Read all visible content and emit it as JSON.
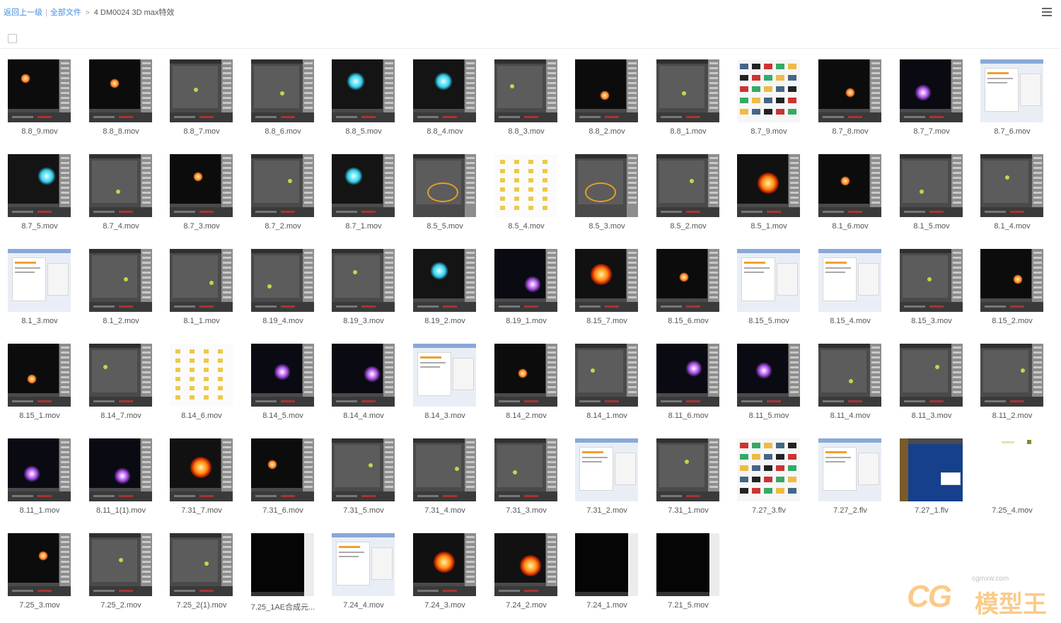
{
  "breadcrumb": {
    "back_label": "返回上一级",
    "all_files_label": "全部文件",
    "current_folder": "4 DM0024 3D max特效"
  },
  "watermark": {
    "brand": "CG",
    "site": "cgmxw.com",
    "name": "模型王"
  },
  "files": [
    {
      "name": "8.8_9.mov",
      "style": "fx-dark"
    },
    {
      "name": "8.8_8.mov",
      "style": "fx-dark"
    },
    {
      "name": "8.8_7.mov",
      "style": "max"
    },
    {
      "name": "8.8_6.mov",
      "style": "max"
    },
    {
      "name": "8.8_5.mov",
      "style": "fx-cyan"
    },
    {
      "name": "8.8_4.mov",
      "style": "fx-cyan"
    },
    {
      "name": "8.8_3.mov",
      "style": "max"
    },
    {
      "name": "8.8_2.mov",
      "style": "fx-dark"
    },
    {
      "name": "8.8_1.mov",
      "style": "max"
    },
    {
      "name": "8.7_9.mov",
      "style": "desktop"
    },
    {
      "name": "8.7_8.mov",
      "style": "fx-dark"
    },
    {
      "name": "8.7_7.mov",
      "style": "fx-purple"
    },
    {
      "name": "8.7_6.mov",
      "style": "window"
    },
    {
      "name": "8.7_5.mov",
      "style": "fx-cyan"
    },
    {
      "name": "8.7_4.mov",
      "style": "max"
    },
    {
      "name": "8.7_3.mov",
      "style": "fx-dark"
    },
    {
      "name": "8.7_2.mov",
      "style": "max"
    },
    {
      "name": "8.7_1.mov",
      "style": "fx-cyan"
    },
    {
      "name": "8.5_5.mov",
      "style": "ring"
    },
    {
      "name": "8.5_4.mov",
      "style": "icons"
    },
    {
      "name": "8.5_3.mov",
      "style": "ring"
    },
    {
      "name": "8.5_2.mov",
      "style": "max"
    },
    {
      "name": "8.5_1.mov",
      "style": "fx-fire"
    },
    {
      "name": "8.1_6.mov",
      "style": "fx-dark"
    },
    {
      "name": "8.1_5.mov",
      "style": "max"
    },
    {
      "name": "8.1_4.mov",
      "style": "max"
    },
    {
      "name": "8.1_3.mov",
      "style": "window"
    },
    {
      "name": "8.1_2.mov",
      "style": "max"
    },
    {
      "name": "8.1_1.mov",
      "style": "max"
    },
    {
      "name": "8.19_4.mov",
      "style": "max"
    },
    {
      "name": "8.19_3.mov",
      "style": "max"
    },
    {
      "name": "8.19_2.mov",
      "style": "fx-cyan"
    },
    {
      "name": "8.19_1.mov",
      "style": "fx-purple"
    },
    {
      "name": "8.15_7.mov",
      "style": "fx-fire"
    },
    {
      "name": "8.15_6.mov",
      "style": "fx-dark"
    },
    {
      "name": "8.15_5.mov",
      "style": "window"
    },
    {
      "name": "8.15_4.mov",
      "style": "window"
    },
    {
      "name": "8.15_3.mov",
      "style": "max"
    },
    {
      "name": "8.15_2.mov",
      "style": "fx-dark"
    },
    {
      "name": "8.15_1.mov",
      "style": "fx-dark"
    },
    {
      "name": "8.14_7.mov",
      "style": "max"
    },
    {
      "name": "8.14_6.mov",
      "style": "icons"
    },
    {
      "name": "8.14_5.mov",
      "style": "fx-purple"
    },
    {
      "name": "8.14_4.mov",
      "style": "fx-purple"
    },
    {
      "name": "8.14_3.mov",
      "style": "window"
    },
    {
      "name": "8.14_2.mov",
      "style": "fx-dark"
    },
    {
      "name": "8.14_1.mov",
      "style": "max"
    },
    {
      "name": "8.11_6.mov",
      "style": "fx-purple"
    },
    {
      "name": "8.11_5.mov",
      "style": "fx-purple"
    },
    {
      "name": "8.11_4.mov",
      "style": "max"
    },
    {
      "name": "8.11_3.mov",
      "style": "max"
    },
    {
      "name": "8.11_2.mov",
      "style": "max"
    },
    {
      "name": "8.11_1.mov",
      "style": "fx-purple"
    },
    {
      "name": "8.11_1(1).mov",
      "style": "fx-purple"
    },
    {
      "name": "7.31_7.mov",
      "style": "fx-fire"
    },
    {
      "name": "7.31_6.mov",
      "style": "fx-dark"
    },
    {
      "name": "7.31_5.mov",
      "style": "max"
    },
    {
      "name": "7.31_4.mov",
      "style": "max"
    },
    {
      "name": "7.31_3.mov",
      "style": "max"
    },
    {
      "name": "7.31_2.mov",
      "style": "window"
    },
    {
      "name": "7.31_1.mov",
      "style": "max"
    },
    {
      "name": "7.27_3.flv",
      "style": "desktop"
    },
    {
      "name": "7.27_2.flv",
      "style": "window"
    },
    {
      "name": "7.27_1.flv",
      "style": "fx-blue"
    },
    {
      "name": "7.25_4.mov",
      "style": "blank"
    },
    {
      "name": "7.25_3.mov",
      "style": "fx-dark"
    },
    {
      "name": "7.25_2.mov",
      "style": "max"
    },
    {
      "name": "7.25_2(1).mov",
      "style": "max"
    },
    {
      "name": "7.25_1AE合成元...",
      "style": "black"
    },
    {
      "name": "7.24_4.mov",
      "style": "window"
    },
    {
      "name": "7.24_3.mov",
      "style": "fx-fire"
    },
    {
      "name": "7.24_2.mov",
      "style": "fx-fire"
    },
    {
      "name": "7.24_1.mov",
      "style": "black"
    },
    {
      "name": "7.21_5.mov",
      "style": "black"
    }
  ]
}
